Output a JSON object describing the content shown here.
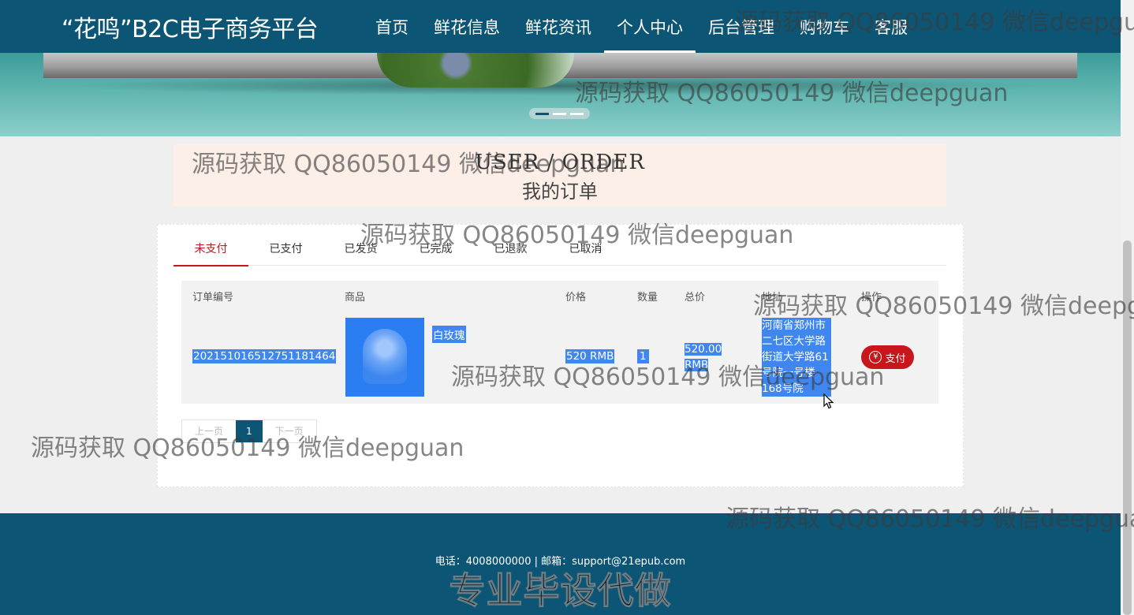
{
  "header": {
    "site_title": "“花鸣”B2C电子商务平台",
    "nav": [
      "首页",
      "鲜花信息",
      "鲜花资讯",
      "个人中心",
      "后台管理",
      "购物车",
      "客服"
    ],
    "active_nav": "个人中心"
  },
  "page_title": {
    "en": "USER / ORDER",
    "cn": "我的订单"
  },
  "tabs": [
    "未支付",
    "已支付",
    "已发货",
    "已完成",
    "已退款",
    "已取消"
  ],
  "active_tab": "未支付",
  "table": {
    "headers": [
      "订单编号",
      "商品",
      "价格",
      "数量",
      "总价",
      "地址",
      "操作"
    ],
    "rows": [
      {
        "order_no": "202151016512751181464",
        "product_name": "白玫瑰",
        "price": "520 RMB",
        "quantity": "1",
        "total_line1": "520.00",
        "total_line2": "RMB",
        "address": "河南省郑州市二七区大学路街道大学路61号院一号楼168号院",
        "action": "支付"
      }
    ]
  },
  "pagination": {
    "prev": "上一页",
    "current": "1",
    "next": "下一页"
  },
  "footer": {
    "contact": "电话：4008000000 | 邮箱：support@21epub.com",
    "slogan": "专业毕设代做"
  },
  "watermark": "源码获取 QQ86050149 微信deepguan",
  "colors": {
    "primary": "#0c5574",
    "accent_red": "#c8161d",
    "selection": "#3f87ee",
    "title_box_bg": "#fcefe8"
  },
  "icons": {
    "pay": "yen-circle-icon",
    "cursor": "mouse-pointer-icon"
  }
}
